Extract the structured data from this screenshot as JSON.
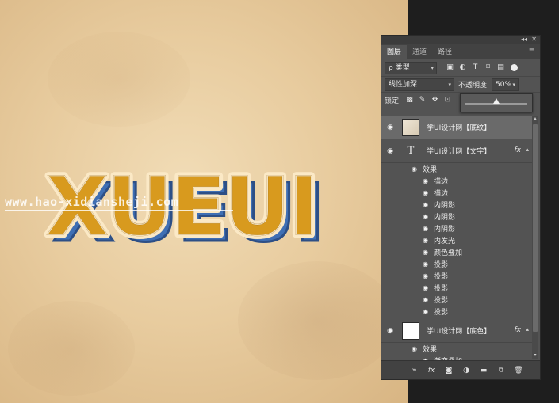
{
  "canvas": {
    "headline": "XUEUI",
    "watermark": "www.hao-xidiansheji.com"
  },
  "panel": {
    "top_controls": {
      "collapse": "◂◂",
      "close": "✕"
    },
    "tabs": [
      {
        "label": "图层",
        "active": true
      },
      {
        "label": "通道",
        "active": false
      },
      {
        "label": "路径",
        "active": false
      }
    ],
    "menu_icon": "≡",
    "filter": {
      "kind_label": "ρ 类型",
      "icons": [
        "image-filter-icon",
        "adjustment-filter-icon",
        "type-filter-icon",
        "shape-filter-icon",
        "smart-object-filter-icon"
      ]
    },
    "blend_mode": "线性加深",
    "opacity_label": "不透明度:",
    "opacity_value": "50%",
    "lock_label": "锁定:",
    "opacity_slider_fraction": 0.5,
    "layers": [
      {
        "name": "学UI设计网【底纹】",
        "kind": "image",
        "selected": true
      },
      {
        "name": "学UI设计网【文字】",
        "kind": "type",
        "selected": false,
        "effects_label": "效果",
        "effects": [
          "描边",
          "描边",
          "内阴影",
          "内阴影",
          "内阴影",
          "内发光",
          "颜色叠加",
          "投影",
          "投影",
          "投影",
          "投影",
          "投影"
        ]
      },
      {
        "name": "学UI设计网【底色】",
        "kind": "fill",
        "selected": false,
        "effects_label": "效果",
        "effects": [
          "渐变叠加"
        ]
      }
    ],
    "fx_label": "fx",
    "colors": {
      "panel": "#535353",
      "selected_layer": "#6a6a6a",
      "headline_fill": "#d89a1e",
      "headline_shadow": "#3f6fb4"
    }
  }
}
